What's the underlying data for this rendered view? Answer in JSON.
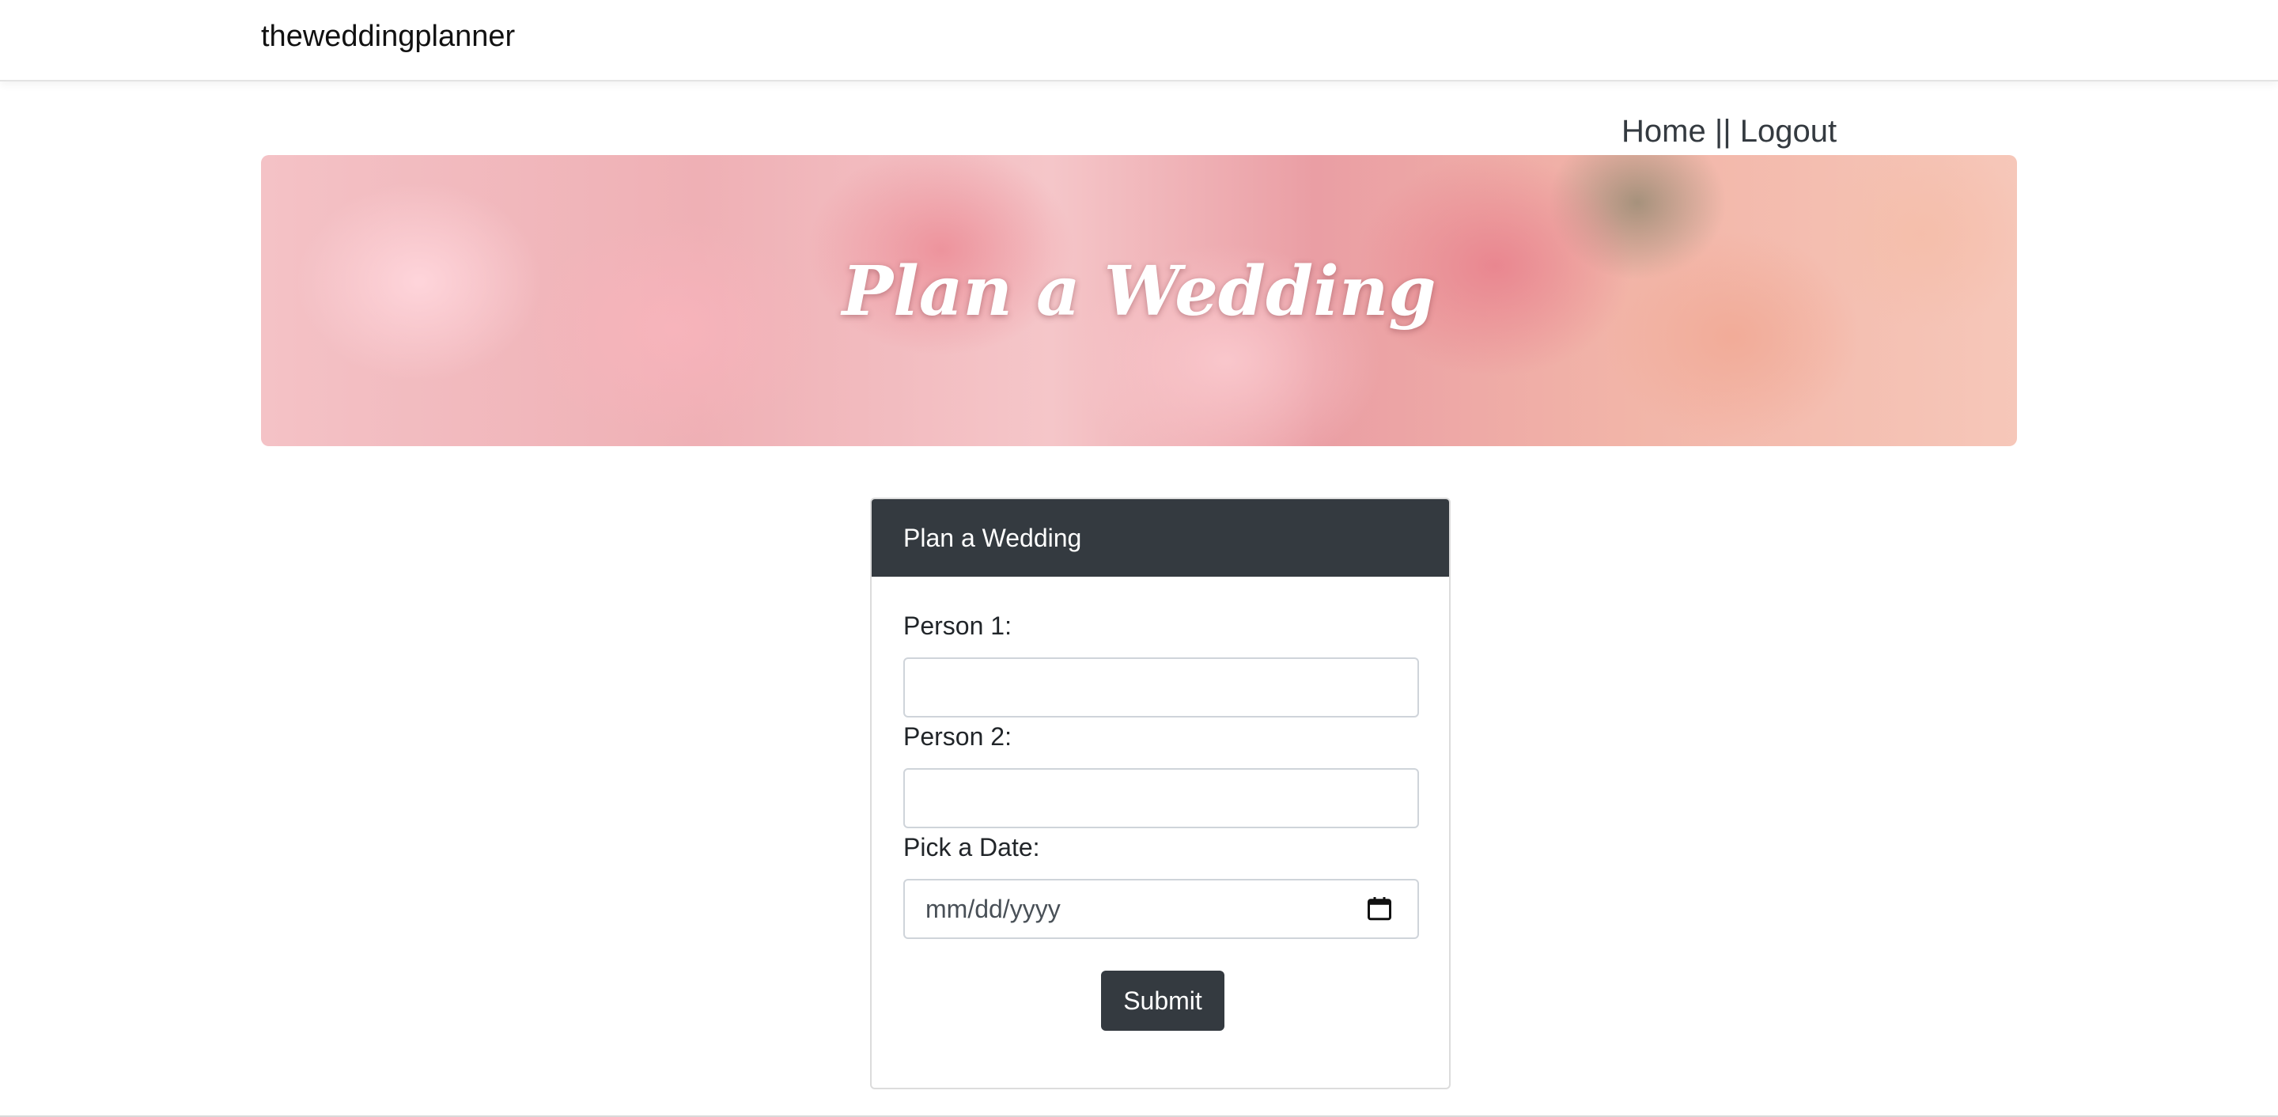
{
  "navbar": {
    "brand": "theweddingplanner"
  },
  "top_links": {
    "home": "Home",
    "separator": " || ",
    "logout": "Logout"
  },
  "banner": {
    "title": "Plan a Wedding"
  },
  "form": {
    "header": "Plan a Wedding",
    "person1_label": "Person 1:",
    "person1_value": "",
    "person2_label": "Person 2:",
    "person2_value": "",
    "date_label": "Pick a Date:",
    "date_placeholder": "mm/dd/yyyy",
    "submit_label": "Submit"
  },
  "icons": {
    "date_picker": "calendar-icon"
  },
  "colors": {
    "dark": "#343a40",
    "banner_text": "#ffffff"
  }
}
